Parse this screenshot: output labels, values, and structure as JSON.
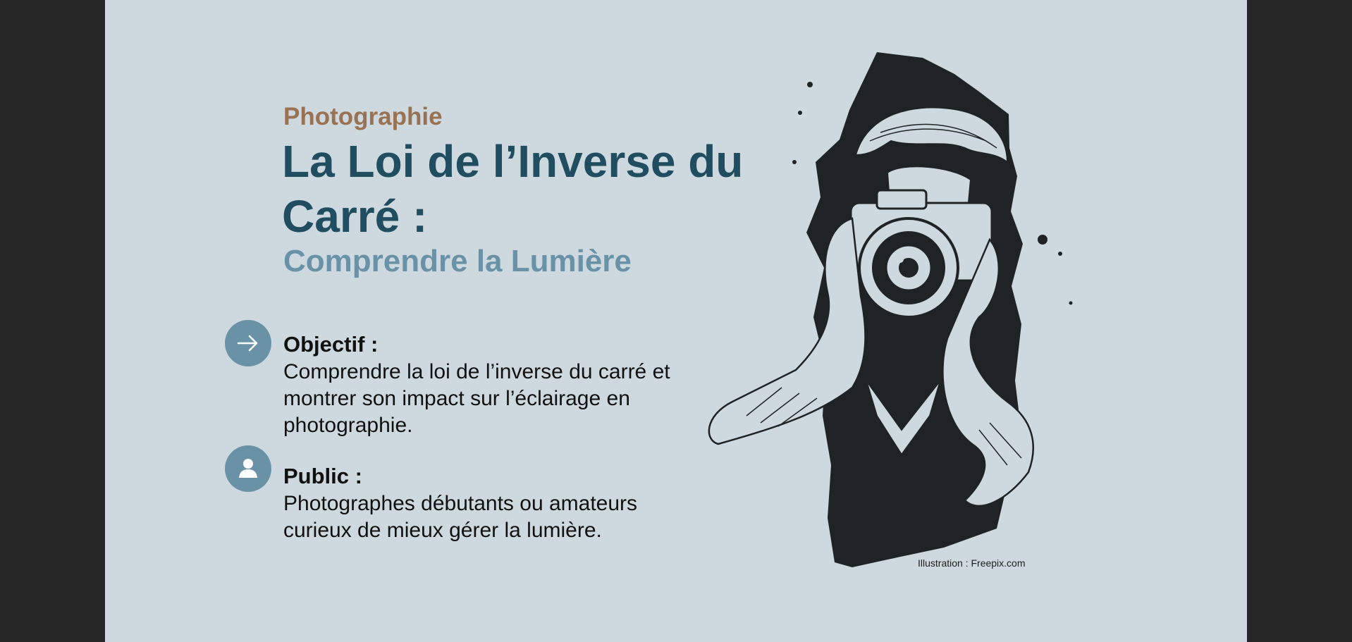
{
  "slide": {
    "kicker": "Photographie",
    "title": "La Loi de l’Inverse du Carré :",
    "subtitle": "Comprendre la Lumière",
    "sections": [
      {
        "icon": "arrow-right-icon",
        "label": "Objectif :",
        "text": "Comprendre la loi de l’inverse du carré et montrer son impact sur l’éclairage en photographie."
      },
      {
        "icon": "user-icon",
        "label": "Public :",
        "text": "Photographes débutants ou amateurs curieux de mieux gérer la lumière."
      }
    ],
    "credit": "Illustration : Freepix.com",
    "illustration_icon": "photographer-illustration-icon"
  },
  "colors": {
    "background": "#cdd9df",
    "outer_frame": "#262626",
    "kicker": "#987252",
    "title": "#214d61",
    "subtitle_and_icons": "#6a92a6",
    "body_text": "#111111"
  }
}
